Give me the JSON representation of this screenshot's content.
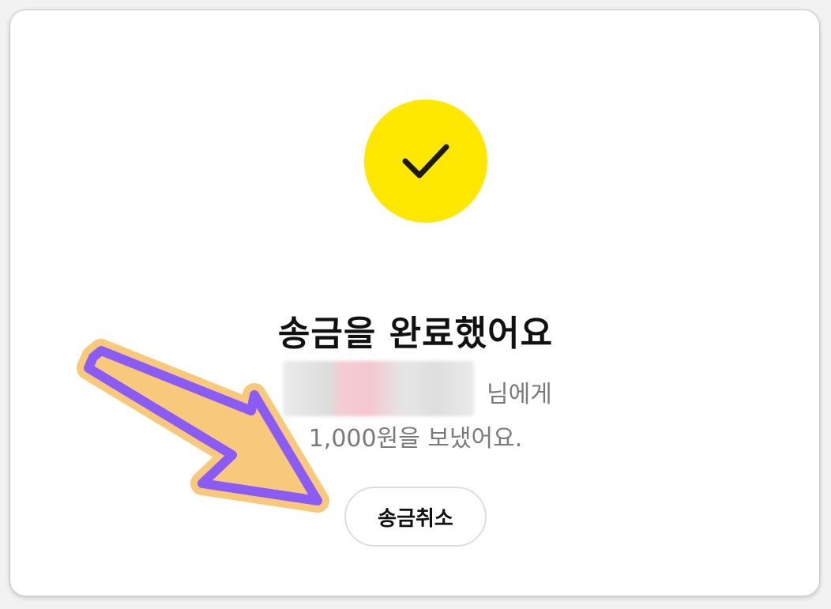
{
  "status": {
    "title": "송금을 완료했어요",
    "recipient_suffix": "님에게",
    "amount_message": "1,000원을 보냈어요."
  },
  "actions": {
    "cancel_label": "송금취소"
  },
  "colors": {
    "check_circle": "#ffe800",
    "checkmark": "#1a1a1a",
    "arrow_fill": "#f8c97a",
    "arrow_outline": "#8a5cf5"
  },
  "icons": {
    "success": "checkmark-icon",
    "annotation": "arrow-icon"
  }
}
